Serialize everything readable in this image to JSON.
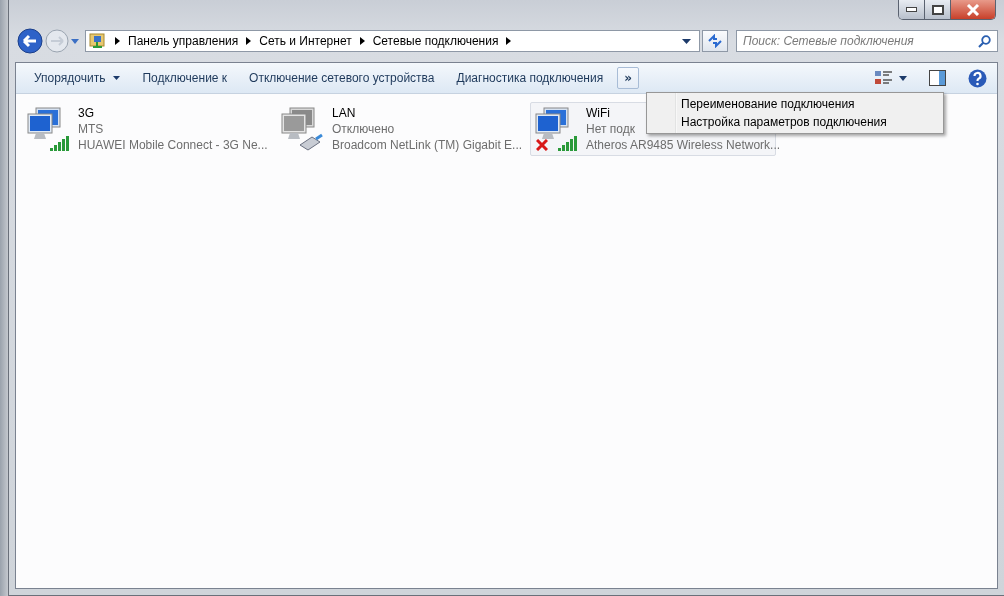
{
  "address": {
    "segments": [
      "Панель управления",
      "Сеть и Интернет",
      "Сетевые подключения"
    ]
  },
  "search": {
    "placeholder": "Поиск: Сетевые подключения"
  },
  "toolbar": {
    "buttons": [
      {
        "label": "Упорядочить",
        "dropdown": true
      },
      {
        "label": "Подключение к",
        "dropdown": false
      },
      {
        "label": "Отключение сетевого устройства",
        "dropdown": false
      },
      {
        "label": "Диагностика подключения",
        "dropdown": false
      }
    ],
    "overflow": "»"
  },
  "overflow_menu": [
    "Переименование подключения",
    "Настройка параметров подключения"
  ],
  "connections": [
    {
      "name": "3G",
      "status": "MTS",
      "device": "HUAWEI Mobile Connect - 3G Ne...",
      "kind": "mobile",
      "disabled": false,
      "error": false,
      "selected": false
    },
    {
      "name": "LAN",
      "status": "Отключено",
      "device": "Broadcom NetLink (TM) Gigabit E...",
      "kind": "wired",
      "disabled": true,
      "error": false,
      "selected": false
    },
    {
      "name": "WiFi",
      "status": "Нет подк",
      "device": "Atheros AR9485 Wireless Network...",
      "kind": "wireless",
      "disabled": false,
      "error": true,
      "selected": true
    }
  ]
}
